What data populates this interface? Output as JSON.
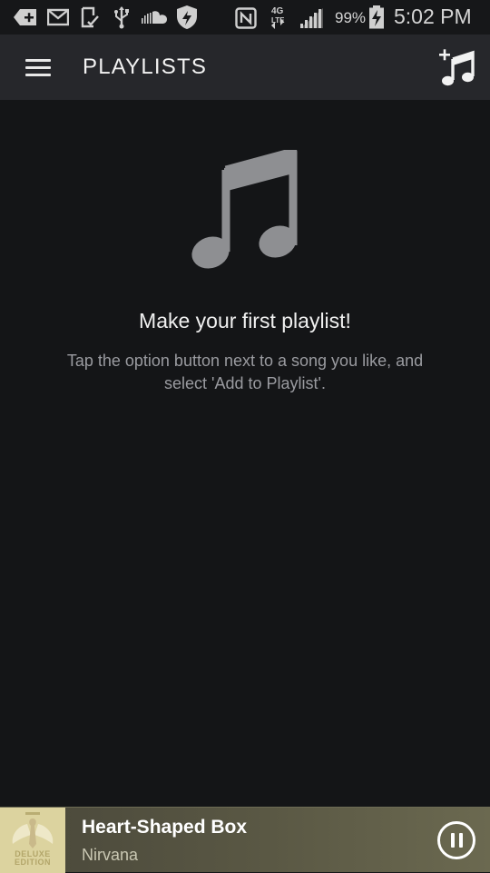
{
  "status_bar": {
    "battery_percent": "99%",
    "time": "5:02 PM",
    "network_type": "4G LTE",
    "icons": [
      "add-icon",
      "mail-icon",
      "clipboard-check-icon",
      "usb-icon",
      "soundcloud-icon",
      "shield-icon",
      "nfc-icon",
      "network-4g-lte-icon",
      "signal-icon",
      "battery-charging-icon"
    ]
  },
  "header": {
    "title": "PLAYLISTS",
    "menu_icon": "hamburger-menu-icon",
    "action_icon": "add-music-note-icon"
  },
  "empty_state": {
    "icon": "music-note-icon",
    "title": "Make your first playlist!",
    "description": "Tap the option button next to a song you like, and select 'Add to Playlist'."
  },
  "now_playing": {
    "track": "Heart-Shaped Box",
    "artist": "Nirvana",
    "album_art_text": "DELUXE EDITION",
    "control_icon": "pause-icon",
    "colors": {
      "bar_start": "#49473a",
      "bar_end": "#6b6950"
    }
  },
  "colors": {
    "background": "#141517",
    "app_bar": "#26272b",
    "note_icon": "#8e8f92"
  }
}
